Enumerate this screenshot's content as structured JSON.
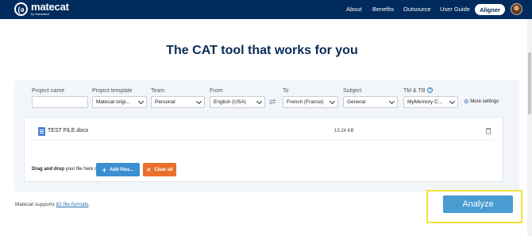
{
  "header": {
    "logo_mark": "(ǝ",
    "logo_name": "matecat",
    "logo_sub": "by translated",
    "nav": [
      "About",
      "Benefits",
      "Outsource",
      "User Guide"
    ],
    "cta": "Aligner"
  },
  "hero": {
    "title": "The CAT tool that works for you"
  },
  "form": {
    "project_name": {
      "label": "Project name",
      "value": ""
    },
    "template": {
      "label": "Project template",
      "value": "Matecat origi..."
    },
    "team": {
      "label": "Team",
      "value": "Personal"
    },
    "from": {
      "label": "From",
      "value": "English (USA)"
    },
    "swap_icon": "⇄",
    "to": {
      "label": "To",
      "value": "French (France)"
    },
    "subject": {
      "label": "Subject",
      "value": "General"
    },
    "tm": {
      "label": "TM & TB",
      "value": "MyMemory C...",
      "help": "?"
    },
    "more_settings": "More settings",
    "gear_icon": "⚙"
  },
  "files": {
    "items": [
      {
        "name": "TEST FILE.docx",
        "size": "13.24 KB"
      }
    ],
    "dnd_bold": "Drag and drop",
    "dnd_rest": " your file here or",
    "add_label": "Add files...",
    "add_icon": "+",
    "clear_label": "Clear all",
    "clear_icon": "✕"
  },
  "footer": {
    "supports_prefix": "Matecat supports ",
    "supports_link": "82 file formats",
    "supports_suffix": ".",
    "analyze": "Analyze"
  },
  "colors": {
    "header_bg": "#002b5c",
    "accent": "#3a8fd0",
    "clear": "#e8702a",
    "highlight": "#f2e13a"
  }
}
